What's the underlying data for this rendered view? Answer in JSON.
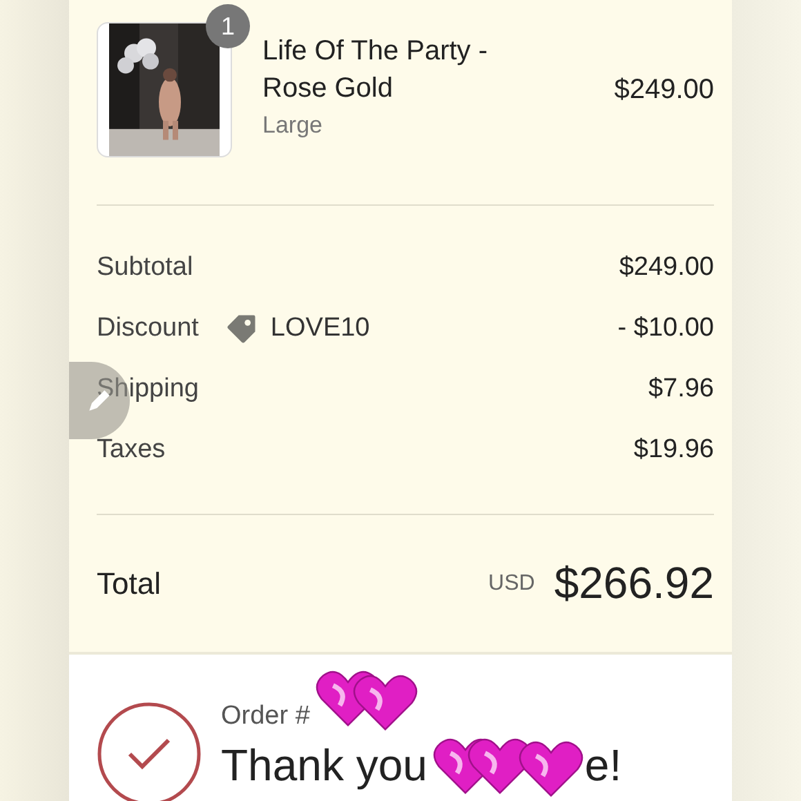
{
  "item": {
    "quantity": "1",
    "name_line1": "Life Of The Party -",
    "name_line2": "Rose Gold",
    "variant": "Large",
    "price": "$249.00"
  },
  "summary": [
    {
      "kind": "plain",
      "label": "Subtotal",
      "value": "$249.00"
    },
    {
      "kind": "discount",
      "label": "Discount",
      "code": "LOVE10",
      "value": "- $10.00"
    },
    {
      "kind": "plain",
      "label": "Shipping",
      "value": "$7.96"
    },
    {
      "kind": "plain",
      "label": "Taxes",
      "value": "$19.96"
    }
  ],
  "total": {
    "label": "Total",
    "currency": "USD",
    "value": "$266.92"
  },
  "confirmation": {
    "order_label": "Order #",
    "thanks_start": "Thank you",
    "thanks_end": "e!"
  }
}
